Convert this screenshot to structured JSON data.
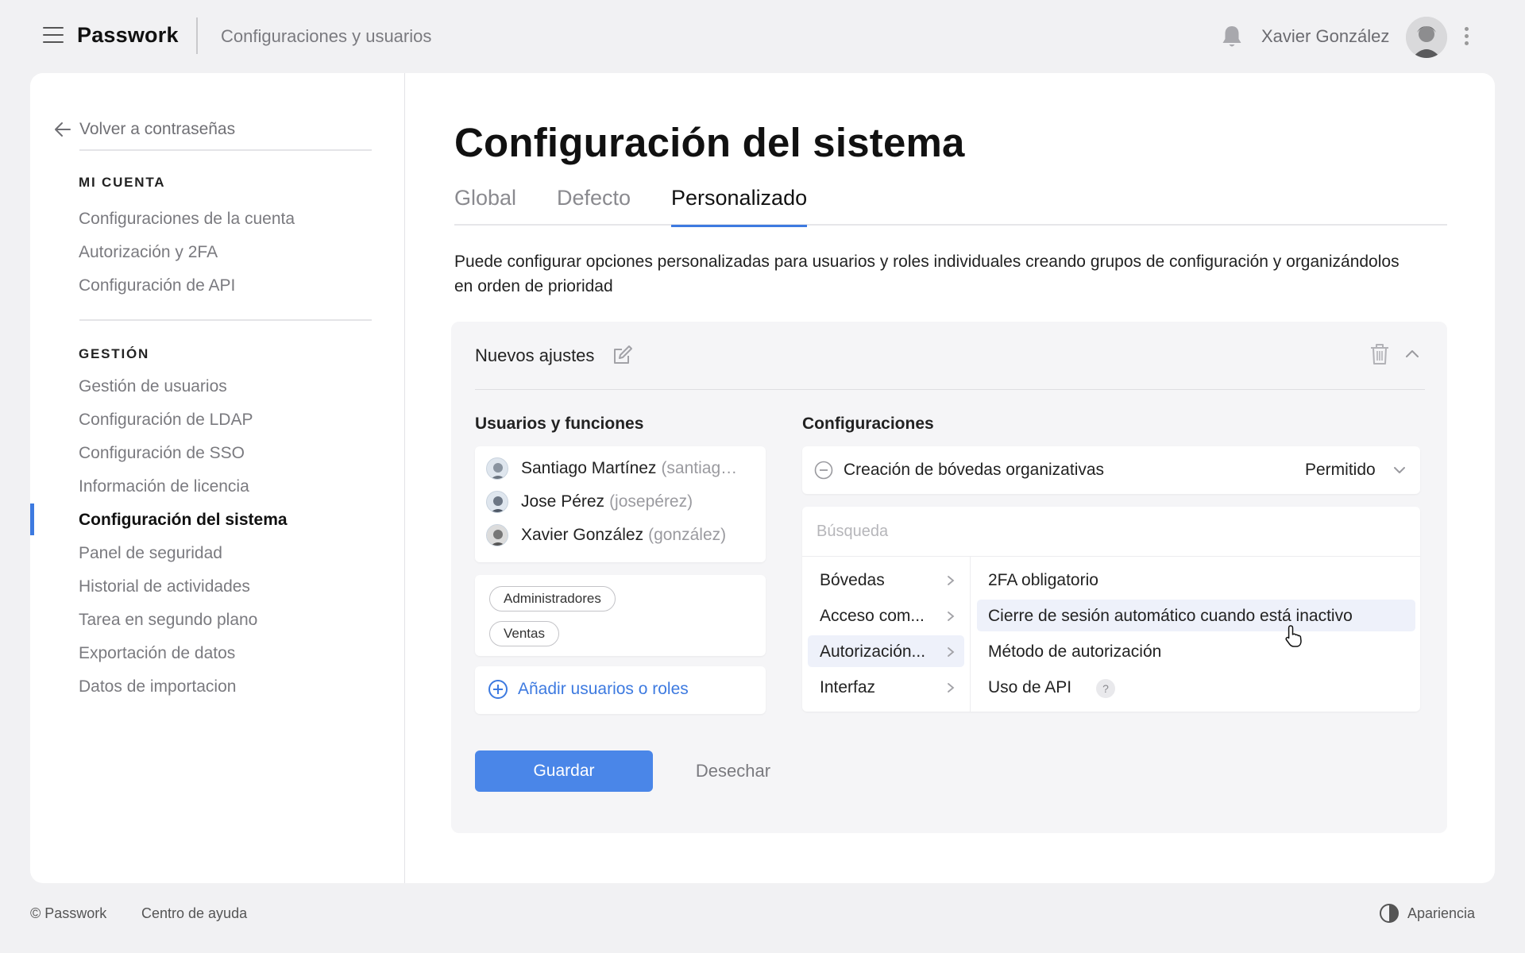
{
  "topbar": {
    "brand": "Passwork",
    "breadcrumb": "Configuraciones y usuarios",
    "user_name": "Xavier González"
  },
  "sidebar": {
    "back_label": "Volver a contraseñas",
    "sections": [
      {
        "heading": "MI CUENTA",
        "items": [
          {
            "label": "Configuraciones de la cuenta"
          },
          {
            "label": "Autorización y 2FA"
          },
          {
            "label": "Configuración de API"
          }
        ]
      },
      {
        "heading": "GESTIÓN",
        "items": [
          {
            "label": "Gestión de usuarios"
          },
          {
            "label": "Configuración de LDAP"
          },
          {
            "label": "Configuración de SSO"
          },
          {
            "label": "Información de licencia"
          },
          {
            "label": "Configuración del sistema",
            "active": true
          },
          {
            "label": "Panel de seguridad"
          },
          {
            "label": "Historial de actividades"
          },
          {
            "label": "Tarea en segundo plano"
          },
          {
            "label": "Exportación de datos"
          },
          {
            "label": "Datos de importacion"
          }
        ]
      }
    ]
  },
  "main": {
    "title": "Configuración del sistema",
    "tabs": [
      {
        "label": "Global"
      },
      {
        "label": "Defecto"
      },
      {
        "label": "Personalizado",
        "active": true
      }
    ],
    "description": "Puede configurar opciones personalizadas para usuarios y roles individuales creando grupos de configuración y organizándolos en orden de prioridad",
    "group": {
      "name": "Nuevos ajustes",
      "users_title": "Usuarios y funciones",
      "users": [
        {
          "name": "Santiago Martínez",
          "login": "(santiag…"
        },
        {
          "name": "Jose Pérez",
          "login": "(josepérez)"
        },
        {
          "name": "Xavier González",
          "login": "(gonzález)"
        }
      ],
      "roles": [
        "Administradores",
        "Ventas"
      ],
      "add_label": "Añadir usuarios o roles",
      "settings_title": "Configuraciones",
      "setting": {
        "name": "Creación de bóvedas organizativas",
        "value": "Permitido"
      },
      "search": {
        "placeholder": "Búsqueda",
        "value": ""
      },
      "categories": [
        {
          "label": "Bóvedas"
        },
        {
          "label": "Acceso com..."
        },
        {
          "label": "Autorización...",
          "active": true
        },
        {
          "label": "Interfaz"
        }
      ],
      "options": [
        {
          "label": "2FA obligatorio"
        },
        {
          "label": "Cierre de sesión automático cuando está inactivo",
          "hover": true
        },
        {
          "label": "Método de autorización"
        },
        {
          "label": "Uso de API",
          "help": "?"
        }
      ],
      "save_label": "Guardar",
      "discard_label": "Desechar"
    }
  },
  "footer": {
    "copyright": "© Passwork",
    "help": "Centro de ayuda",
    "appearance": "Apariencia"
  },
  "colors": {
    "accent": "#3d7ae0",
    "button": "#4a86e8",
    "background": "#f1f1f3",
    "selected_row": "#eef1fa"
  },
  "icons": [
    "hamburger-icon",
    "bell-icon",
    "kebab-icon",
    "arrow-left-icon",
    "edit-icon",
    "trash-icon",
    "chevron-up-icon",
    "minus-circle-icon",
    "chevron-down-icon",
    "chevron-right-icon",
    "plus-circle-icon",
    "pointer-cursor-icon",
    "contrast-icon",
    "help-icon"
  ]
}
